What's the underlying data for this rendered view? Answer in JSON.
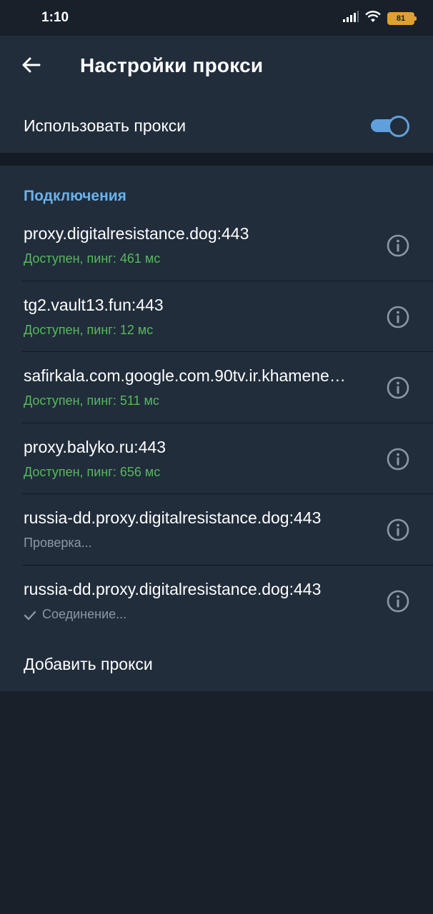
{
  "status_bar": {
    "time": "1:10",
    "battery": "81",
    "icons": [
      "signal-icon",
      "wifi-icon",
      "battery-icon"
    ]
  },
  "app_bar": {
    "back_icon": "arrow-left-icon",
    "title": "Настройки прокси"
  },
  "use_proxy": {
    "label": "Использовать прокси",
    "enabled": true
  },
  "connections": {
    "header": "Подключения",
    "items": [
      {
        "host": "proxy.digitalresistance.dog:443",
        "status": "Доступен, пинг: 461 мс",
        "state": "available",
        "checked": false
      },
      {
        "host": "tg2.vault13.fun:443",
        "status": "Доступен, пинг: 12 мс",
        "state": "available",
        "checked": false
      },
      {
        "host": "safirkala.com.google.com.90tv.ir.khamene…",
        "status": "Доступен, пинг: 511 мс",
        "state": "available",
        "checked": false
      },
      {
        "host": "proxy.balyko.ru:443",
        "status": "Доступен, пинг: 656 мс",
        "state": "available",
        "checked": false
      },
      {
        "host": "russia-dd.proxy.digitalresistance.dog:443",
        "status": "Проверка...",
        "state": "checking",
        "checked": false
      },
      {
        "host": "russia-dd.proxy.digitalresistance.dog:443",
        "status": "Соединение...",
        "state": "connecting",
        "checked": true
      }
    ],
    "add_label": "Добавить прокси"
  },
  "colors": {
    "background": "#18202a",
    "surface": "#212d3b",
    "accent": "#6ab2ec",
    "toggle": "#5fa0dc",
    "available": "#57b85d",
    "muted": "#8c97a3",
    "battery": "#e0a030"
  }
}
